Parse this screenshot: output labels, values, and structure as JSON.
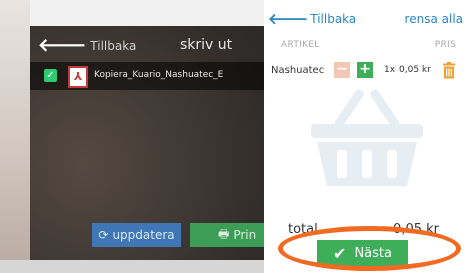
{
  "dialog": {
    "back_label": "Tillbaka",
    "title": "skriv ut",
    "file": {
      "checked": true,
      "icon": "pdf-icon",
      "name": "Kopiera_Kuario_Nashuatec_E"
    },
    "update_label": "uppdatera",
    "print_label": "Prin"
  },
  "cart": {
    "back_label": "Tillbaka",
    "clear_label": "rensa alla",
    "col_article": "ARTIKEL",
    "col_price": "PRIS",
    "item": {
      "name": "Nashuatec",
      "qty": "1x",
      "price": "0,05 kr"
    },
    "total_label": "total",
    "total_value": "0,05 kr",
    "next_label": "Nästa"
  },
  "colors": {
    "accent_blue": "#2e86c1",
    "green": "#3fae58",
    "minus_disabled": "#f4c6b6",
    "highlight": "#f26a21",
    "trash": "#f0a030"
  }
}
